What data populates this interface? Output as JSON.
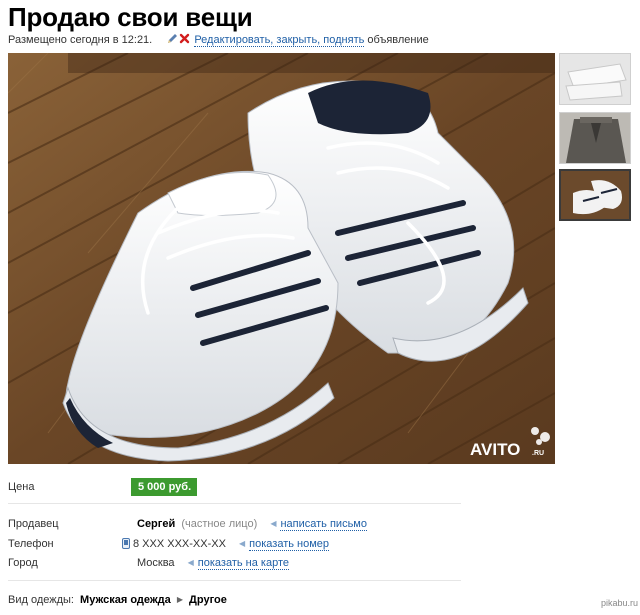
{
  "listing": {
    "title": "Продаю свои вещи",
    "posted": "Размещено сегодня в 12:21.",
    "edit_link": "Редактировать, закрыть, поднять",
    "edit_suffix": " объявление"
  },
  "photo": {
    "watermark": "AVITO",
    "watermark_suffix": ".RU",
    "thumbnails": [
      "trousers-photo",
      "jacket-photo",
      "sneakers-photo"
    ],
    "selected_thumbnail": 3
  },
  "details": {
    "price_label": "Цена",
    "price_value": "5 000 руб.",
    "seller_label": "Продавец",
    "seller_name": "Сергей",
    "seller_type": "(частное лицо)",
    "write_message": "написать письмо",
    "phone_label": "Телефон",
    "phone_value": "8 XXX XXX-XX-XX",
    "show_number": "показать номер",
    "city_label": "Город",
    "city_value": "Москва",
    "show_on_map": "показать на карте"
  },
  "category": {
    "label": "Вид одежды:",
    "level1": "Мужская одежда",
    "level2": "Другое"
  },
  "site_watermark": "pikabu.ru",
  "colors": {
    "link": "#1f5fa6",
    "price_badge": "#3c9a2f",
    "floor": "#6b4a2c"
  }
}
